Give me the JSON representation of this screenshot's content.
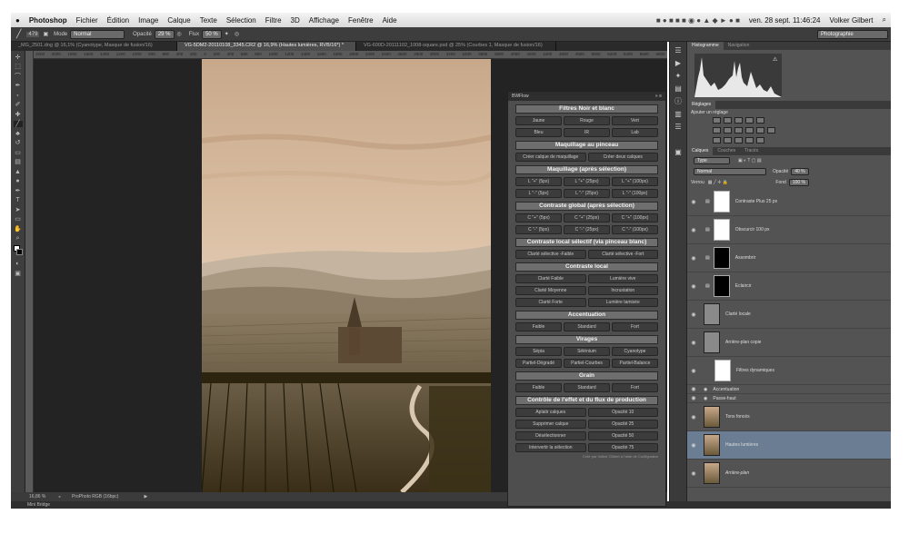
{
  "menubar": {
    "apple": "",
    "app": "Photoshop",
    "items": [
      "Fichier",
      "Édition",
      "Image",
      "Calque",
      "Texte",
      "Sélection",
      "Filtre",
      "3D",
      "Affichage",
      "Fenêtre",
      "Aide"
    ],
    "clock": "ven. 28 sept.  11:46:24",
    "user": "Volker Gilbert"
  },
  "options": {
    "brush_size": "479",
    "mode_label": "Mode",
    "mode": "Normal",
    "opacity_label": "Opacité",
    "opacity": "29 %",
    "flow_label": "Flux",
    "flow": "50 %",
    "workspace": "Photographie"
  },
  "tabs": [
    "_MG_2501.dng @ 16,1% (Cyanotype, Masque de fusion/16)",
    "VG-5DM2-20110108_3345.CR2 @ 16,9% (Hautes lumières, RVB/16*) *",
    "VG-600D-20111102_1008-square.psd @ 25% (Courbes 1, Masque de fusion/16)"
  ],
  "ruler_ticks": [
    "2200",
    "2000",
    "1800",
    "1600",
    "1400",
    "1200",
    "1000",
    "800",
    "600",
    "400",
    "200",
    "0",
    "200",
    "400",
    "600",
    "800",
    "1000",
    "1200",
    "1400",
    "1600",
    "1800",
    "2000",
    "2200",
    "2400",
    "2600",
    "2800",
    "3000",
    "3200",
    "3400",
    "3600",
    "3800",
    "4000",
    "4200",
    "4400",
    "4600",
    "4800",
    "5000",
    "5200",
    "5400",
    "5600",
    "5800"
  ],
  "status": {
    "zoom": "16,86 %",
    "profile": "ProPhoto RGB (16bpc)"
  },
  "minibridge": "Mini Bridge",
  "bwflow": {
    "title": "BWFlow",
    "sections": [
      {
        "title": "Filtres Noir et blanc",
        "rows": [
          [
            "Jaune",
            "Rouge",
            "Vert"
          ],
          [
            "Bleu",
            "IR",
            "Lab"
          ]
        ]
      },
      {
        "title": "Maquillage au pinceau",
        "rows": [
          [
            "Créer calque de maquillage",
            "Créer deux calques"
          ]
        ]
      },
      {
        "title": "Maquillage (après sélection)",
        "rows": [
          [
            "L \"+\" (5px)",
            "L \"+\" (25px)",
            "L \"+\" (100px)"
          ],
          [
            "L \"-\" (5px)",
            "L \"-\" (25px)",
            "L \"-\" (100px)"
          ]
        ]
      },
      {
        "title": "Contraste global (après sélection)",
        "rows": [
          [
            "C \"+\" (5px)",
            "C \"+\" (25px)",
            "C \"+\" (100px)"
          ],
          [
            "C \"-\" (5px)",
            "C \"-\" (25px)",
            "C \"-\" (100px)"
          ]
        ]
      },
      {
        "title": "Contraste local sélectif (via pinceau blanc)",
        "rows": [
          [
            "Clarté sélective -Faible",
            "Clarté sélective -Fort"
          ]
        ]
      },
      {
        "title": "Contraste local",
        "rows": [
          [
            "Clarté Faible",
            "Lumière vive"
          ],
          [
            "Clarté Moyenne",
            "Incrustation"
          ],
          [
            "Clarté Forte",
            "Lumière tamisée"
          ]
        ]
      },
      {
        "title": "Accentuation",
        "rows": [
          [
            "Faible",
            "Standard",
            "Fort"
          ]
        ]
      },
      {
        "title": "Virages",
        "rows": [
          [
            "Sépia",
            "Sélénium",
            "Cyanotype"
          ],
          [
            "Partiel-Dégradé",
            "Partiel-Courbes",
            "Partiel-Balance"
          ]
        ]
      },
      {
        "title": "Grain",
        "rows": [
          [
            "Faible",
            "Standard",
            "Fort"
          ]
        ]
      },
      {
        "title": "Contrôle de l'effet et du flux de production",
        "rows": [
          [
            "Aplatir calques",
            "Opacité 10"
          ],
          [
            "Supprimer calque",
            "Opacité 25"
          ],
          [
            "Désélectionner",
            "Opacité 50"
          ],
          [
            "Intervertir la sélection",
            "Opacité 75"
          ]
        ]
      }
    ],
    "footer": "Créé par Volker Gilbert à l'aide de Configurator"
  },
  "panels": {
    "histo_tabs": [
      "Histogramme",
      "Navigation"
    ],
    "adj_tab": "Réglages",
    "adj_label": "Ajouter un réglage",
    "layer_tabs": [
      "Calques",
      "Couches",
      "Tracés"
    ],
    "filter_type": "Type",
    "blend": "Normal",
    "opacity_label": "Opacité",
    "opacity": "40 %",
    "lock_label": "Verrou",
    "fill_label": "Fond",
    "fill": "100 %",
    "layers": [
      "Contraste Plus 25 px",
      "Obscurcir 100 px",
      "Assombrir",
      "Eclaircir",
      "Clarté locale",
      "Arrière-plan copie",
      "Filtres dynamiques",
      "Accentuation",
      "Passe-haut",
      "Tons foncés",
      "Hautes lumières",
      "Arrière-plan"
    ]
  }
}
